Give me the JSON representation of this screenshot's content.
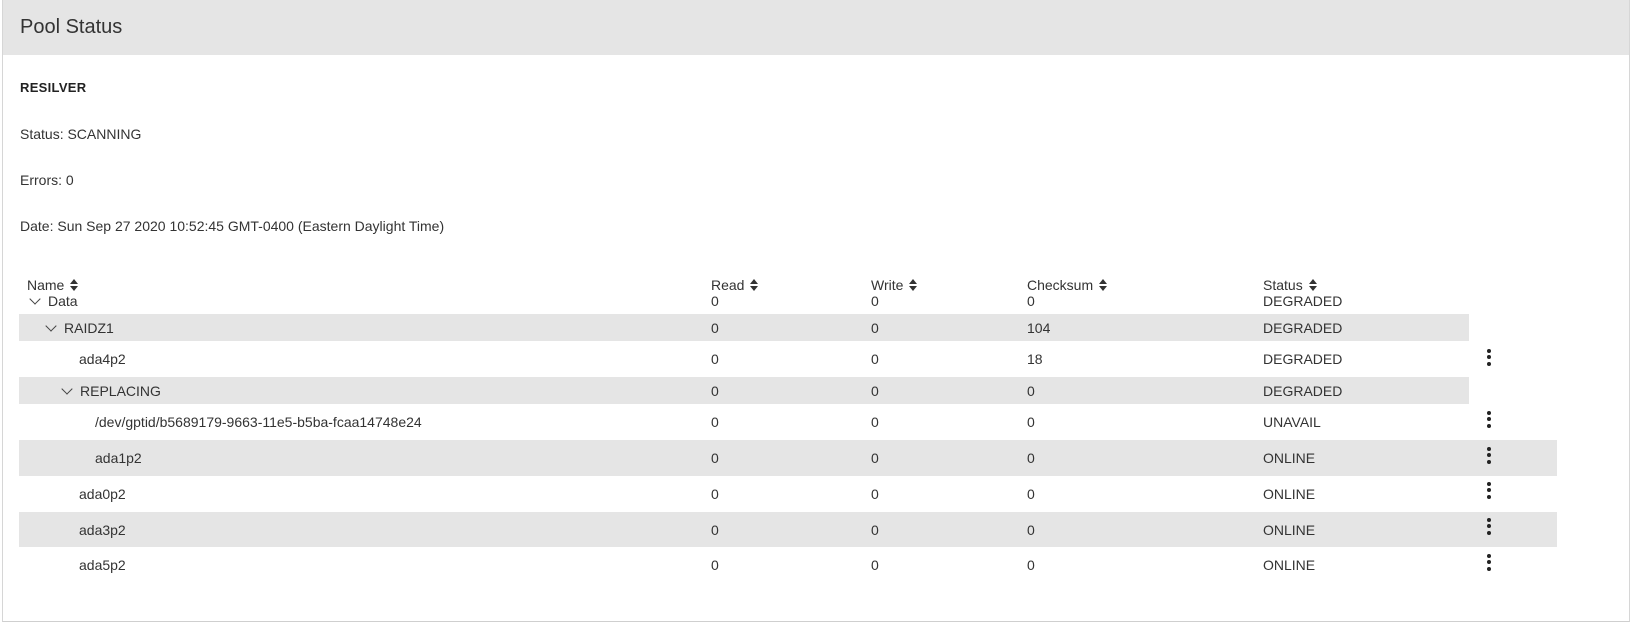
{
  "card": {
    "title": "Pool Status"
  },
  "scan": {
    "section_title": "RESILVER",
    "status": "Status: SCANNING",
    "errors": "Errors: 0",
    "date": "Date: Sun Sep 27 2020 10:52:45 GMT-0400 (Eastern Daylight Time)"
  },
  "table": {
    "columns": [
      "Name",
      "Read",
      "Write",
      "Checksum",
      "Status"
    ],
    "rows": [
      {
        "name": "Data",
        "read": "0",
        "write": "0",
        "checksum": "0",
        "status": "DEGRADED",
        "expanded": true,
        "shaded": false,
        "actions": false
      },
      {
        "name": "RAIDZ1",
        "read": "0",
        "write": "0",
        "checksum": "104",
        "status": "DEGRADED",
        "expanded": true,
        "shaded": true,
        "actions": false
      },
      {
        "name": "ada4p2",
        "read": "0",
        "write": "0",
        "checksum": "18",
        "status": "DEGRADED",
        "expanded": false,
        "shaded": false,
        "actions": true
      },
      {
        "name": "REPLACING",
        "read": "0",
        "write": "0",
        "checksum": "0",
        "status": "DEGRADED",
        "expanded": true,
        "shaded": true,
        "actions": false
      },
      {
        "name": "/dev/gptid/b5689179-9663-11e5-b5ba-fcaa14748e24",
        "read": "0",
        "write": "0",
        "checksum": "0",
        "status": "UNAVAIL",
        "expanded": false,
        "shaded": false,
        "actions": true
      },
      {
        "name": "ada1p2",
        "read": "0",
        "write": "0",
        "checksum": "0",
        "status": "ONLINE",
        "expanded": false,
        "shaded": true,
        "actions": true
      },
      {
        "name": "ada0p2",
        "read": "0",
        "write": "0",
        "checksum": "0",
        "status": "ONLINE",
        "expanded": false,
        "shaded": false,
        "actions": true
      },
      {
        "name": "ada3p2",
        "read": "0",
        "write": "0",
        "checksum": "0",
        "status": "ONLINE",
        "expanded": false,
        "shaded": true,
        "actions": true
      },
      {
        "name": "ada5p2",
        "read": "0",
        "write": "0",
        "checksum": "0",
        "status": "ONLINE",
        "expanded": false,
        "shaded": false,
        "actions": true
      }
    ]
  },
  "icons": {
    "sort": "sort-icon",
    "expand": "chevron-down-icon",
    "actions": "more-vert-icon"
  }
}
